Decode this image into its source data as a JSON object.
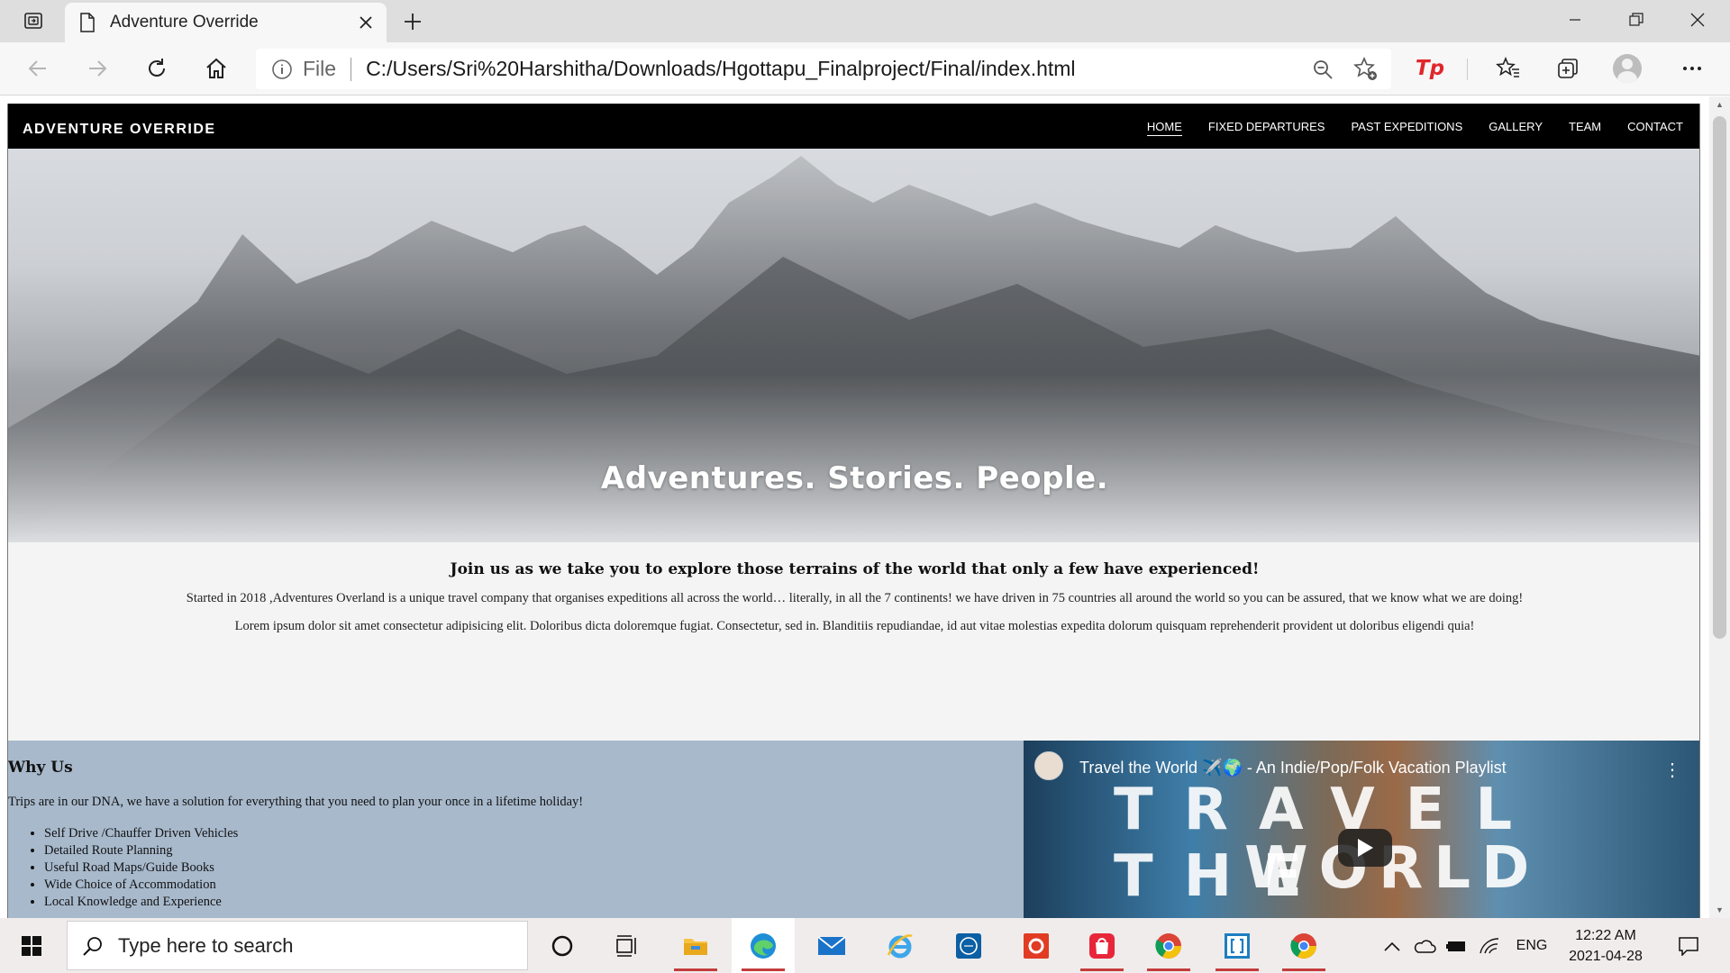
{
  "browser": {
    "tab_title": "Adventure Override",
    "address_scheme": "File",
    "address_url": "C:/Users/Sri%20Harshitha/Downloads/Hgottapu_Finalproject/Final/index.html"
  },
  "site": {
    "brand": "ADVENTURE OVERRIDE",
    "menu": [
      {
        "label": "HOME"
      },
      {
        "label": "FIXED DEPARTURES"
      },
      {
        "label": "PAST EXPEDITIONS"
      },
      {
        "label": "GALLERY"
      },
      {
        "label": "TEAM"
      },
      {
        "label": "CONTACT"
      }
    ],
    "hero_heading": "Adventures. Stories. People.",
    "intro": {
      "heading": "Join us as we take you to explore those terrains of the world that only a few have experienced!",
      "p1": "Started in 2018 ,Adventures Overland is a unique travel company that organises expeditions all across the world… literally, in all the 7 continents! we have driven in 75 countries all around the world so you can be assured, that we know what we are doing!",
      "p2": "Lorem ipsum dolor sit amet consectetur adipisicing elit. Doloribus dicta doloremque fugiat. Consectetur, sed in. Blanditiis repudiandae, id aut vitae molestias expedita dolorum quisquam reprehenderit provident ut doloribus eligendi quia!"
    },
    "why_us": {
      "heading": "Why Us",
      "text": "Trips are in our DNA, we have a solution for everything that you need to plan your once in a lifetime holiday!",
      "items": [
        "Self Drive /Chauffer Driven Vehicles",
        "Detailed Route Planning",
        "Useful Road Maps/Guide Books",
        "Wide Choice of Accommodation",
        "Local Knowledge and Experience"
      ]
    },
    "video": {
      "title": "Travel the World ✈️🌍 - An Indie/Pop/Folk Vacation Playlist",
      "overlay_line1": "TRAVEL THE",
      "overlay_line2": "WORLD"
    }
  },
  "taskbar": {
    "search_placeholder": "Type here to search",
    "language": "ENG",
    "time": "12:22 AM",
    "date": "2021-04-28"
  }
}
